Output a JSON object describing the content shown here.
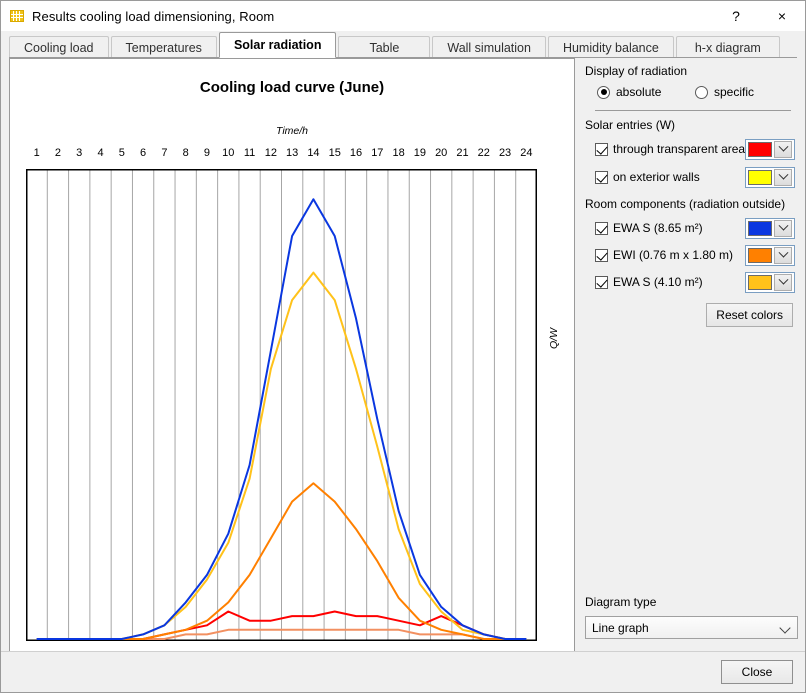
{
  "window": {
    "title": "Results cooling load dimensioning, Room",
    "icon": "grid-icon",
    "help_label": "?",
    "close_label": "×"
  },
  "tabs": [
    {
      "label": "Cooling load",
      "active": false
    },
    {
      "label": "Temperatures",
      "active": false
    },
    {
      "label": "Solar radiation",
      "active": true
    },
    {
      "label": "Table",
      "active": false
    },
    {
      "label": "Wall simulation",
      "active": false
    },
    {
      "label": "Humidity balance",
      "active": false
    },
    {
      "label": "h-x diagram",
      "active": false
    }
  ],
  "panel": {
    "display_group": "Display of radiation",
    "radio_absolute": "absolute",
    "radio_specific": "specific",
    "radio_selected": "absolute",
    "solar_group": "Solar entries (W)",
    "solar_items": [
      {
        "label": "through transparent areas",
        "checked": true,
        "color": "#FF0000"
      },
      {
        "label": "on exterior walls",
        "checked": true,
        "color": "#FFFF00"
      }
    ],
    "components_group": "Room components (radiation outside)",
    "component_items": [
      {
        "label": "EWA S (8.65 m²)",
        "checked": true,
        "color": "#0A37E0"
      },
      {
        "label": "EWI (0.76 m x 1.80 m)",
        "checked": true,
        "color": "#FF8000"
      },
      {
        "label": "EWA S (4.10 m²)",
        "checked": true,
        "color": "#FFC21A"
      }
    ],
    "reset_colors_label": "Reset colors",
    "diagram_type_label": "Diagram type",
    "diagram_type_value": "Line graph"
  },
  "footer": {
    "close_label": "Close"
  },
  "chart_data": {
    "type": "line",
    "title": "Cooling load curve (June)",
    "xlabel": "Time/h",
    "ylabel": "Q/W",
    "x": [
      1,
      2,
      3,
      4,
      5,
      6,
      7,
      8,
      9,
      10,
      11,
      12,
      13,
      14,
      15,
      16,
      17,
      18,
      19,
      20,
      21,
      22,
      23,
      24
    ],
    "categories": [
      "1",
      "2",
      "3",
      "4",
      "5",
      "6",
      "7",
      "8",
      "9",
      "10",
      "11",
      "12",
      "13",
      "14",
      "15",
      "16",
      "17",
      "18",
      "19",
      "20",
      "21",
      "22",
      "23",
      "24"
    ],
    "ylim": [
      0,
      100
    ],
    "xlim": [
      1,
      24
    ],
    "grid": "vertical",
    "legend": "none",
    "series": [
      {
        "name": "EWA S (8.65 m²)",
        "color": "#0A37E0",
        "values": [
          0,
          0,
          0,
          0,
          0,
          1,
          3,
          8,
          14,
          23,
          38,
          63,
          88,
          96,
          88,
          70,
          48,
          28,
          14,
          7,
          3,
          1,
          0,
          0
        ]
      },
      {
        "name": "on exterior walls",
        "color": "#FFC21A",
        "values": [
          0,
          0,
          0,
          0,
          0,
          1,
          3,
          7,
          13,
          21,
          35,
          59,
          74,
          80,
          74,
          59,
          42,
          24,
          12,
          6,
          2,
          1,
          0,
          0
        ]
      },
      {
        "name": "EWI (0.76 m x 1.80 m)",
        "color": "#FF8000",
        "values": [
          0,
          0,
          0,
          0,
          0,
          0,
          1,
          2,
          4,
          8,
          14,
          22,
          30,
          34,
          30,
          24,
          17,
          9,
          4,
          2,
          1,
          0,
          0,
          0
        ]
      },
      {
        "name": "through transparent areas",
        "color": "#FF0000",
        "values": [
          0,
          0,
          0,
          0,
          0,
          0,
          1,
          2,
          3,
          6,
          4,
          4,
          5,
          5,
          6,
          5,
          5,
          4,
          3,
          5,
          3,
          1,
          0,
          0
        ]
      },
      {
        "name": "EWA S (4.10 m²)",
        "color": "#F29061",
        "values": [
          0,
          0,
          0,
          0,
          0,
          0,
          0,
          1,
          1,
          2,
          2,
          2,
          2,
          2,
          2,
          2,
          2,
          2,
          1,
          1,
          1,
          0,
          0,
          0
        ]
      }
    ]
  }
}
